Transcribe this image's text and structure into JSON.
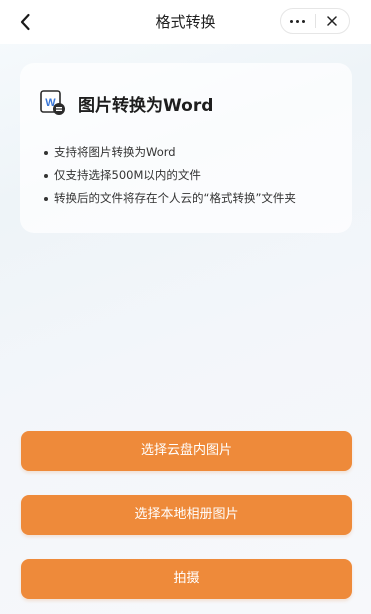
{
  "nav": {
    "title": "格式转换",
    "back_icon": "chevron-left-icon",
    "more_icon": "more-dots-icon",
    "close_icon": "close-icon"
  },
  "card": {
    "title": "图片转换为Word",
    "icon": "word-document-icon",
    "bullets": [
      "支持将图片转换为Word",
      "仅支持选择500M以内的文件",
      "转换后的文件将存在个人云的“格式转换”文件夹"
    ]
  },
  "actions": {
    "cloud_label": "选择云盘内图片",
    "album_label": "选择本地相册图片",
    "camera_label": "拍摄"
  },
  "colors": {
    "accent": "#ee8a3a",
    "word_blue": "#3b78d8"
  }
}
